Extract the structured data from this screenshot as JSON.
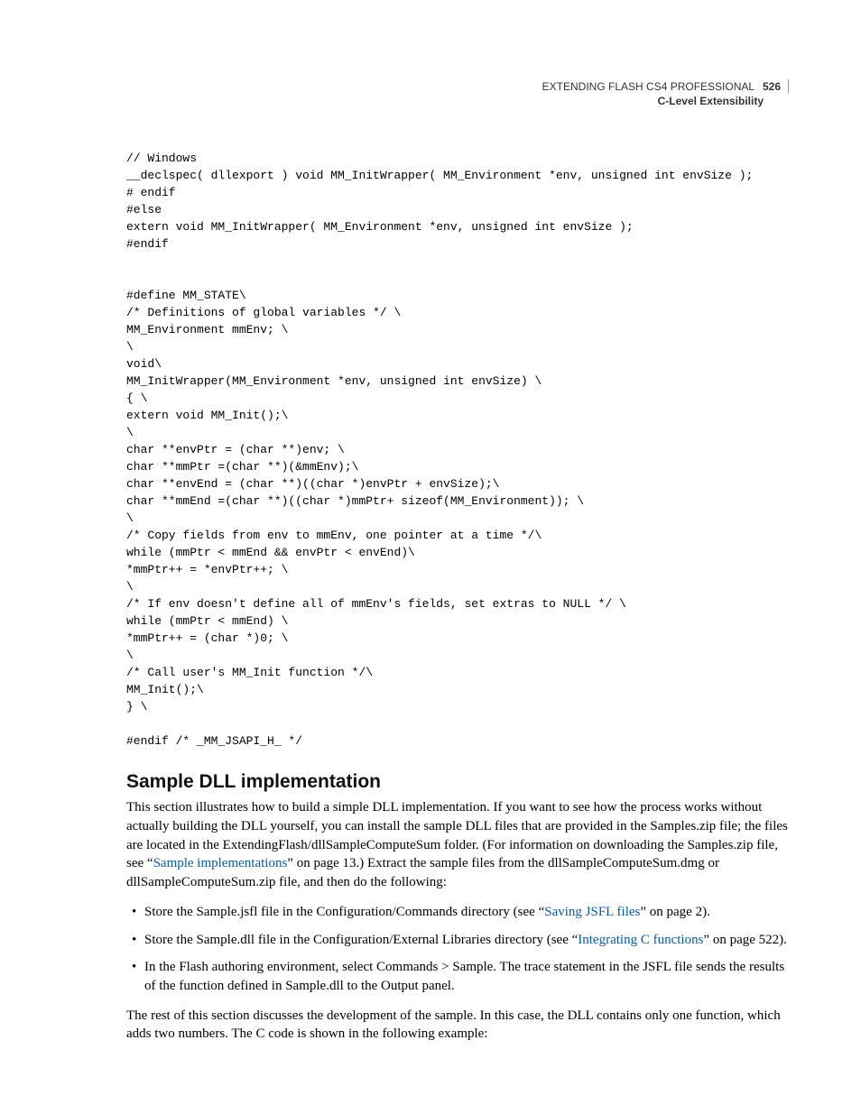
{
  "header": {
    "book_title": "EXTENDING FLASH CS4 PROFESSIONAL",
    "page_number": "526",
    "chapter": "C-Level Extensibility"
  },
  "code_block": "// Windows\n__declspec( dllexport ) void MM_InitWrapper( MM_Environment *env, unsigned int envSize );\n# endif\n#else\nextern void MM_InitWrapper( MM_Environment *env, unsigned int envSize );\n#endif\n\n\n#define MM_STATE\\\n/* Definitions of global variables */ \\\nMM_Environment mmEnv; \\\n\\\nvoid\\\nMM_InitWrapper(MM_Environment *env, unsigned int envSize) \\\n{ \\\nextern void MM_Init();\\\n\\\nchar **envPtr = (char **)env; \\\nchar **mmPtr =(char **)(&mmEnv);\\\nchar **envEnd = (char **)((char *)envPtr + envSize);\\\nchar **mmEnd =(char **)((char *)mmPtr+ sizeof(MM_Environment)); \\\n\\\n/* Copy fields from env to mmEnv, one pointer at a time */\\\nwhile (mmPtr < mmEnd && envPtr < envEnd)\\\n*mmPtr++ = *envPtr++; \\\n\\\n/* If env doesn't define all of mmEnv's fields, set extras to NULL */ \\\nwhile (mmPtr < mmEnd) \\\n*mmPtr++ = (char *)0; \\\n\\\n/* Call user's MM_Init function */\\\nMM_Init();\\\n} \\\n\n#endif /* _MM_JSAPI_H_ */",
  "section_heading": "Sample DLL implementation",
  "para1_a": "This section illustrates how to build a simple DLL implementation. If you want to see how the process works without actually building the DLL yourself, you can install the sample DLL files that are provided in the Samples.zip file; the files are located in the ExtendingFlash/dllSampleComputeSum folder. (For information on downloading the Samples.zip file, see “",
  "para1_link": "Sample implementations",
  "para1_b": "” on page 13.) Extract the sample files from the dllSampleComputeSum.dmg or dllSampleComputeSum.zip file, and then do the following:",
  "bullet1_a": "Store the Sample.jsfl file in the Configuration/Commands directory (see “",
  "bullet1_link": "Saving JSFL files",
  "bullet1_b": "” on page 2).",
  "bullet2_a": "Store the Sample.dll file in the Configuration/External Libraries directory (see “",
  "bullet2_link": "Integrating C functions",
  "bullet2_b": "” on page 522).",
  "bullet3": "In the Flash authoring environment, select Commands > Sample. The trace statement in the JSFL file sends the results of the function defined in Sample.dll to the Output panel.",
  "para2": "The rest of this section discusses the development of the sample. In this case, the DLL contains only one function, which adds two numbers. The C code is shown in the following example:"
}
